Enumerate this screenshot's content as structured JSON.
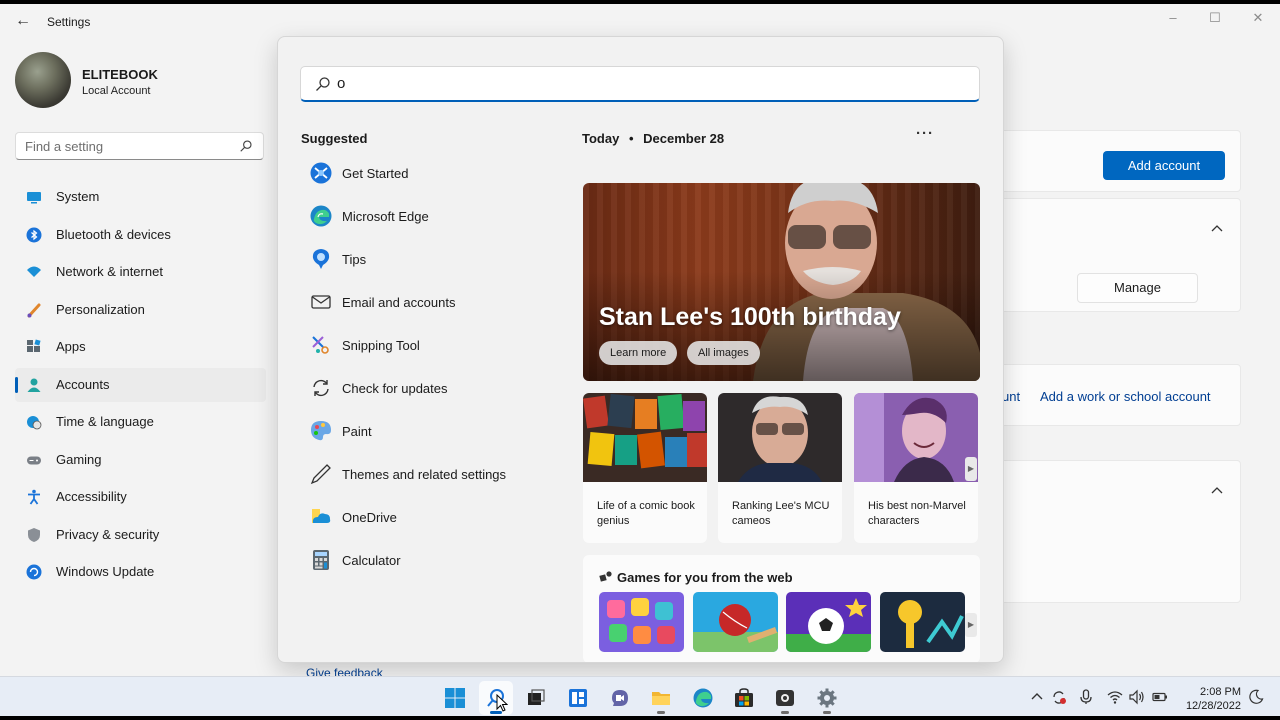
{
  "window": {
    "title": "Settings",
    "back_icon": "back-arrow-icon",
    "controls": {
      "minimize": "–",
      "maximize": "☐",
      "close": "✕"
    }
  },
  "profile": {
    "name": "ELITEBOOK",
    "account_type": "Local Account"
  },
  "find_setting": {
    "placeholder": "Find a setting"
  },
  "sidebar": {
    "items": [
      {
        "label": "System",
        "icon": "system-icon"
      },
      {
        "label": "Bluetooth & devices",
        "icon": "bluetooth-icon"
      },
      {
        "label": "Network & internet",
        "icon": "wifi-icon"
      },
      {
        "label": "Personalization",
        "icon": "brush-icon"
      },
      {
        "label": "Apps",
        "icon": "apps-icon"
      },
      {
        "label": "Accounts",
        "icon": "accounts-icon",
        "active": true
      },
      {
        "label": "Time & language",
        "icon": "globe-clock-icon"
      },
      {
        "label": "Gaming",
        "icon": "gamepad-icon"
      },
      {
        "label": "Accessibility",
        "icon": "accessibility-icon"
      },
      {
        "label": "Privacy & security",
        "icon": "shield-icon"
      },
      {
        "label": "Windows Update",
        "icon": "update-icon"
      }
    ]
  },
  "accounts_page": {
    "add_account_label": "Add account",
    "manage_label": "Manage",
    "partial_link": "unt",
    "work_school_link": "Add a work or school account",
    "feedback": "Give feedback"
  },
  "search_panel": {
    "query": "o",
    "suggested_heading": "Suggested",
    "suggested": [
      {
        "label": "Get Started",
        "icon": "get-started-icon"
      },
      {
        "label": "Microsoft Edge",
        "icon": "edge-icon"
      },
      {
        "label": "Tips",
        "icon": "tips-icon"
      },
      {
        "label": "Email and accounts",
        "icon": "mail-icon"
      },
      {
        "label": "Snipping Tool",
        "icon": "snipping-tool-icon"
      },
      {
        "label": "Check for updates",
        "icon": "refresh-icon"
      },
      {
        "label": "Paint",
        "icon": "paint-icon"
      },
      {
        "label": "Themes and related settings",
        "icon": "pen-icon"
      },
      {
        "label": "OneDrive",
        "icon": "onedrive-icon"
      },
      {
        "label": "Calculator",
        "icon": "calculator-icon"
      }
    ],
    "today": "Today",
    "separator": "•",
    "date": "December 28",
    "more": "···",
    "hero": {
      "title": "Stan Lee's 100th birthday",
      "buttons": [
        "Learn more",
        "All images"
      ]
    },
    "stories": [
      {
        "text": "Life of a comic book genius"
      },
      {
        "text": "Ranking Lee's MCU cameos"
      },
      {
        "text": "His best non-Marvel characters"
      }
    ],
    "games_heading": "Games for you from the web"
  },
  "taskbar": {
    "apps": [
      "start-icon",
      "search-icon",
      "task-view-icon",
      "widgets-icon",
      "teams-chat-icon",
      "file-explorer-icon",
      "edge-icon",
      "store-icon",
      "camera-app-icon",
      "settings-icon"
    ],
    "time": "2:08 PM",
    "date": "12/28/2022"
  },
  "colors": {
    "accent": "#005fb8",
    "button_primary": "#0067c0",
    "link": "#003e92"
  }
}
